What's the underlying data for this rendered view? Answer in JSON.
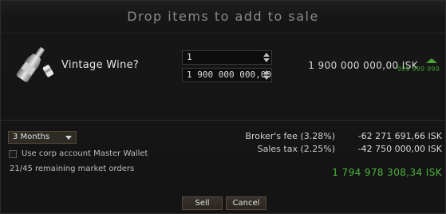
{
  "window": {
    "title": "Drop items to add to sale"
  },
  "item": {
    "name": "Vintage Wine?",
    "icon": "wine-bottle-icon",
    "quantity": "1",
    "price": "1 900 000 000,00",
    "total_price": "1 900 000 000,00  ISK",
    "reference_price": "999 999 999"
  },
  "order": {
    "duration": "3 Months",
    "corp_wallet_label": "Use corp account Master Wallet",
    "corp_wallet_checked": false,
    "remaining_orders": "21/45 remaining market orders"
  },
  "fees": {
    "broker_label": "Broker's fee  (3.28%)",
    "broker_value": "-62 271 691,66  ISK",
    "tax_label": "Sales tax  (2.25%)",
    "tax_value": "-42 750 000,00  ISK",
    "net_total": "1 794 978 308,34  ISK"
  },
  "buttons": {
    "sell": "Sell",
    "cancel": "Cancel"
  },
  "colors": {
    "positive": "#4fb33c",
    "accent_border": "#5a4b3c",
    "background": "#141414"
  }
}
